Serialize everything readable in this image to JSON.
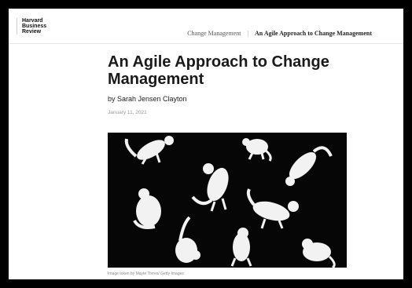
{
  "site": {
    "logo_line1": "Harvard",
    "logo_line2": "Business",
    "logo_line3": "Review"
  },
  "breadcrumb": {
    "section": "Change Management",
    "separator": "|",
    "current": "An Agile Approach to Change Management"
  },
  "article": {
    "title": "An Agile Approach to Change Management",
    "byline": "by Sarah Jensen Clayton",
    "date": "January 11, 2021",
    "image_caption": "Image token by Mayte Torres/ Getty Images"
  },
  "colors": {
    "page_background": "#ffffff",
    "frame": "#000000",
    "title": "#1a1a1a",
    "muted": "#999999",
    "hero_background": "#060606",
    "cat_fur": "#f2f2f2"
  },
  "icons": {
    "hero_image": "white-cats-on-black-photo"
  }
}
